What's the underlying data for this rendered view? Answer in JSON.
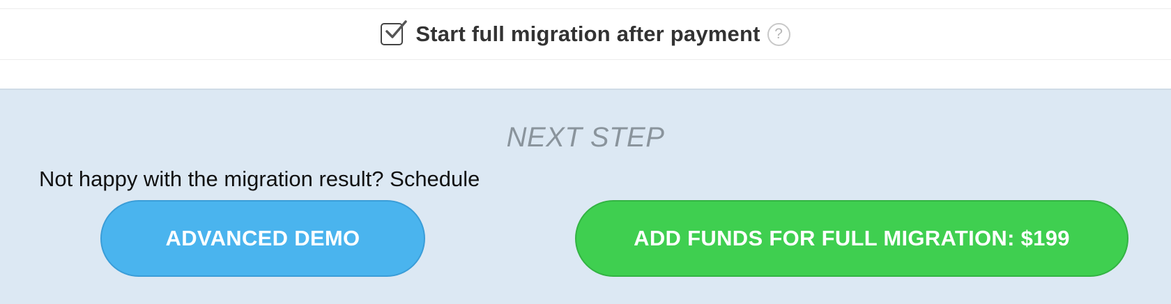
{
  "option": {
    "label": "Start full migration after payment",
    "checked": true,
    "help_glyph": "?"
  },
  "next_step": {
    "title": "NEXT STEP",
    "demo_prompt": "Not happy with the migration result? Schedule",
    "demo_button_label": "ADVANCED DEMO",
    "funds_button_label": "ADD FUNDS FOR FULL MIGRATION: $199"
  },
  "colors": {
    "panel_background": "#dce8f3",
    "demo_button": "#4ab4ee",
    "funds_button": "#3fcf50"
  }
}
